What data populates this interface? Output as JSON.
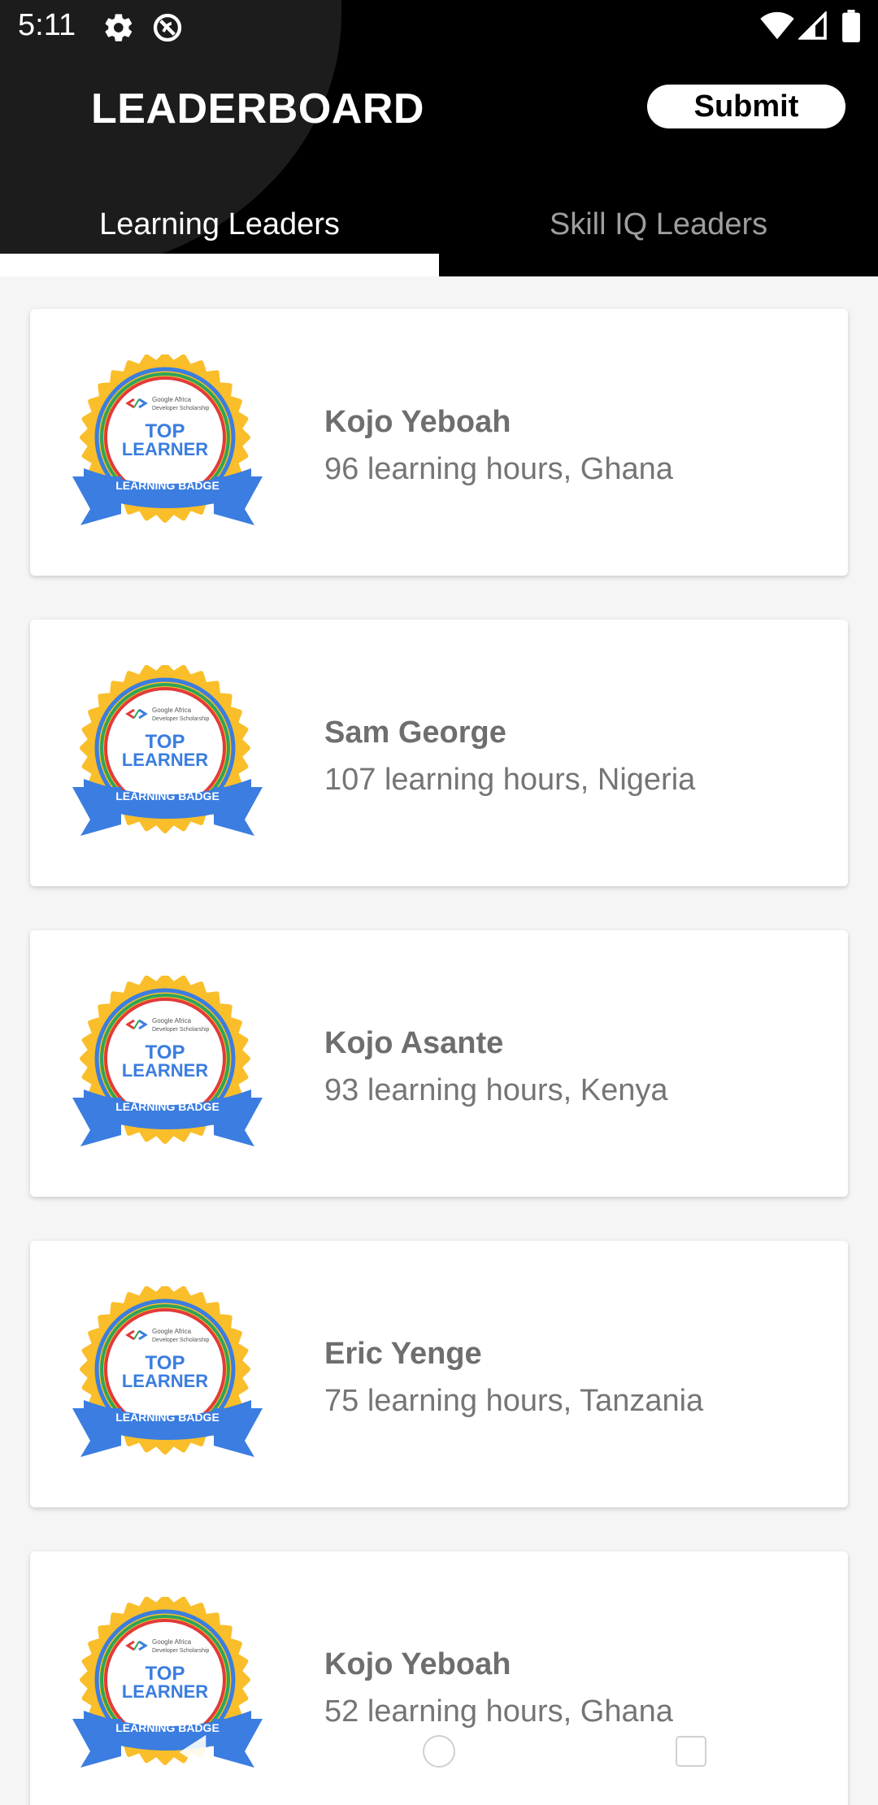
{
  "status_bar": {
    "time": "5:11",
    "icons": [
      "gear-icon",
      "dnd-icon",
      "wifi-icon",
      "signal-icon",
      "battery-icon"
    ]
  },
  "header": {
    "title": "LEADERBOARD",
    "submit_label": "Submit"
  },
  "tabs": [
    {
      "label": "Learning Leaders",
      "selected": true
    },
    {
      "label": "Skill IQ Leaders",
      "selected": false
    }
  ],
  "badge": {
    "line1": "Google Africa",
    "line2": "Developer Scholarship",
    "top": "TOP",
    "learner": "LEARNER",
    "ribbon": "LEARNING BADGE"
  },
  "leaders": [
    {
      "name": "Kojo Yeboah",
      "details": "96 learning hours, Ghana"
    },
    {
      "name": "Sam George",
      "details": "107 learning hours, Nigeria"
    },
    {
      "name": "Kojo Asante",
      "details": "93 learning hours, Kenya"
    },
    {
      "name": "Eric Yenge",
      "details": "75 learning hours, Tanzania"
    },
    {
      "name": "Kojo Yeboah",
      "details": "52 learning hours, Ghana"
    }
  ],
  "colors": {
    "appbar": "#000000",
    "badge_gold": "#F9BE2A",
    "badge_blue": "#3B7DE0",
    "badge_red": "#E23B3B",
    "badge_green": "#2FA45A"
  }
}
